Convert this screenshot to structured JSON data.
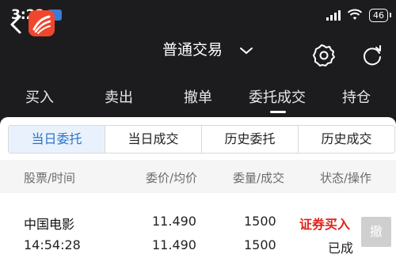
{
  "status_bar": {
    "time": "3:22",
    "battery": "46"
  },
  "app_bar": {
    "title": "普通交易"
  },
  "tabs": [
    {
      "label": "买入"
    },
    {
      "label": "卖出"
    },
    {
      "label": "撤单"
    },
    {
      "label": "委托成交"
    },
    {
      "label": "持仓"
    }
  ],
  "segments": [
    {
      "label": "当日委托",
      "active": true
    },
    {
      "label": "当日成交",
      "active": false
    },
    {
      "label": "历史委托",
      "active": false
    },
    {
      "label": "历史成交",
      "active": false
    }
  ],
  "table": {
    "headers": {
      "stock_time": "股票/时间",
      "price": "委价/均价",
      "qty": "委量/成交",
      "status": "状态/操作"
    },
    "rows": [
      {
        "name": "中国电影",
        "time": "14:54:28",
        "order_price": "11.490",
        "avg_price": "11.490",
        "order_qty": "1500",
        "filled_qty": "1500",
        "action": "证券买入",
        "status": "已成",
        "cancel_label": "撤"
      }
    ]
  },
  "colors": {
    "background": "#1c1c1e",
    "accent_blue": "#2b73c7",
    "buy_red": "#e0231a",
    "logo_orange": "#f0462c"
  },
  "icons": [
    "back-arrow-icon",
    "app-logo",
    "chevron-down-icon",
    "gear-icon",
    "refresh-icon"
  ]
}
